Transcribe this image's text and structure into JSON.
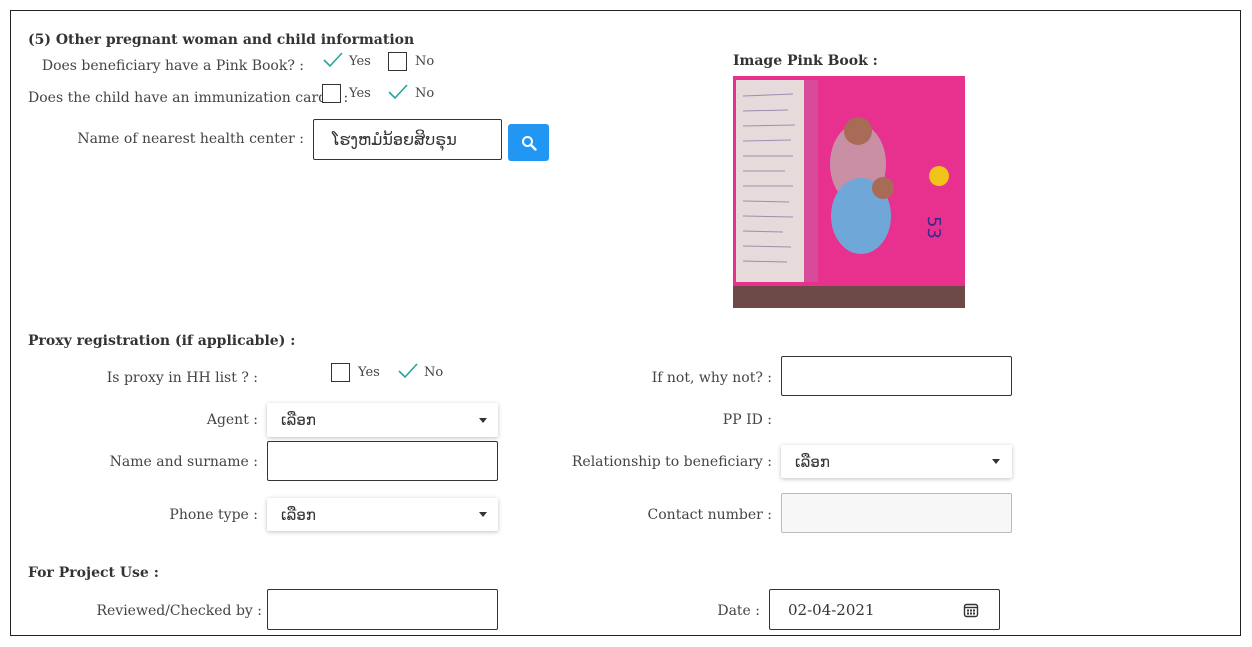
{
  "section5": {
    "title": "(5) Other pregnant woman and child information",
    "pink_book_question": "Does beneficiary have a Pink Book? :",
    "immunization_question": "Does the child have an immunization card ? :",
    "health_center_label": "Name of nearest health center :",
    "health_center_value": "ໂຮງຫມໍນ້ອຍສິບຣຸນ",
    "yes": "Yes",
    "no": "No",
    "pink_book_answer": "Yes",
    "immunization_answer": "No",
    "image_label": "Image Pink Book :"
  },
  "proxy": {
    "title": "Proxy registration (if applicable) :",
    "in_hh_list_label": "Is proxy in HH list ? :",
    "in_hh_list_answer": "No",
    "if_not_label": "If not, why not? :",
    "agent_label": "Agent :",
    "agent_value": "ເລືອກ",
    "pp_id_label": "PP ID :",
    "name_label": "Name and surname :",
    "relationship_label": "Relationship to beneficiary :",
    "relationship_value": "ເລືອກ",
    "phone_type_label": "Phone type :",
    "phone_type_value": "ເລືອກ",
    "contact_label": "Contact number :"
  },
  "project": {
    "title": "For Project Use :",
    "reviewed_label": "Reviewed/Checked by :",
    "date_label": "Date :",
    "date_value": "02-04-2021"
  },
  "colors": {
    "check": "#26a69a",
    "search_button": "#2196f3",
    "pink_book": "#e8308f"
  }
}
